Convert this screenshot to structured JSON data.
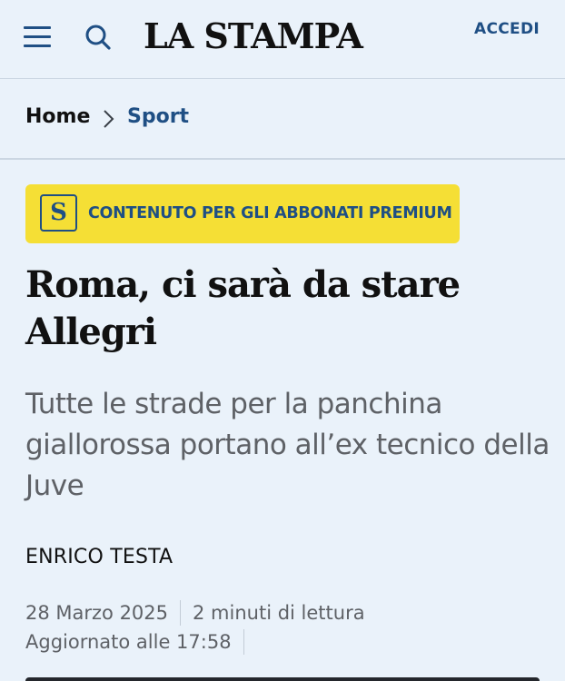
{
  "header": {
    "logo": "LA STAMPA",
    "login_label": "ACCEDI",
    "menu_icon": "hamburger-menu-icon",
    "search_icon": "search-icon"
  },
  "breadcrumb": {
    "home": "Home",
    "separator_icon": "chevron-right-icon",
    "section": "Sport"
  },
  "premium_badge": {
    "logo_letter": "S",
    "label": "CONTENUTO PER GLI ABBONATI PREMIUM",
    "background": "#f5df35",
    "text_color": "#1f4f84"
  },
  "article": {
    "title": "Roma, ci sarà da stare Allegri",
    "subtitle": "Tutte le strade per la panchina giallorossa portano all’ex tecnico della Juve",
    "author": "ENRICO TESTA",
    "date": "28 Marzo 2025",
    "reading_time": "2 minuti di lettura",
    "updated": "Aggiornato alle 17:58"
  },
  "colors": {
    "background": "#eaf2fa",
    "accent": "#1f4f84",
    "muted_text": "#5e6166"
  }
}
